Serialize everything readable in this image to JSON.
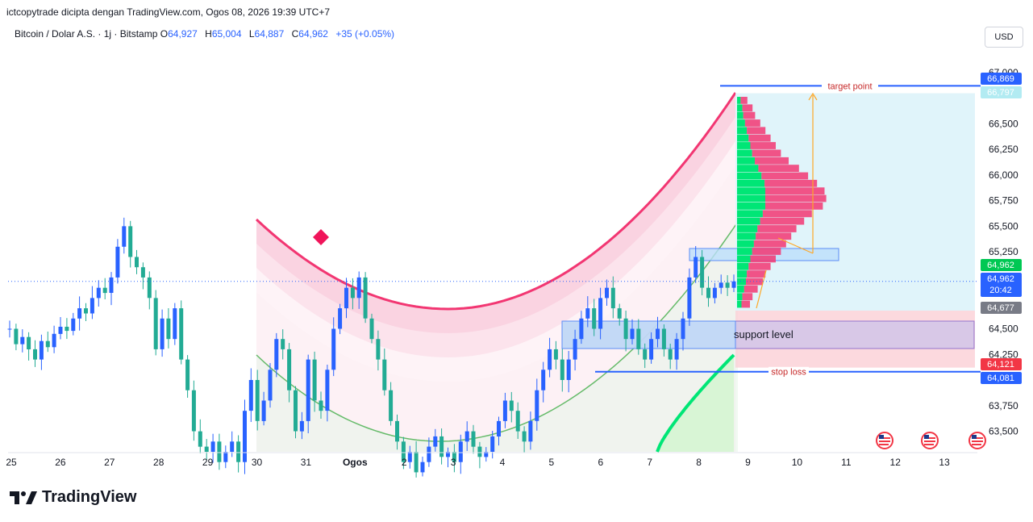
{
  "header": {
    "caption": "ictcopytrade dicipta dengan TradingView.com, Ogos 08, 2026 19:39 UTC+7"
  },
  "legend": {
    "symbol": "Bitcoin / Dolar A.S. · 1j · Bitstamp",
    "o_label": "O",
    "o": "64,927",
    "h_label": "H",
    "h": "65,004",
    "l_label": "L",
    "l": "64,887",
    "c_label": "C",
    "c": "64,962",
    "change": "+35 (+0.05%)"
  },
  "currency_button": "USD",
  "footer": {
    "brand": "TradingView"
  },
  "colors": {
    "up": "#2962ff",
    "down": "#22ab94",
    "arc": "#f23672",
    "target": "#2962ff",
    "stop": "#2962ff"
  },
  "chart_data": {
    "type": "line",
    "x_tick_labels": [
      "25",
      "26",
      "27",
      "28",
      "29",
      "30",
      "31",
      "Ogos",
      "2",
      "3",
      "4",
      "5",
      "6",
      "7",
      "8",
      "9",
      "10",
      "11",
      "12",
      "13"
    ],
    "y_tick_labels": [
      67000,
      66500,
      66250,
      66000,
      65750,
      65500,
      65250,
      64500,
      64250,
      63750,
      63500
    ],
    "ylim": [
      63300,
      67250
    ],
    "price_tags": [
      {
        "value": 66869,
        "label": "66,869",
        "color": "#2962ff"
      },
      {
        "value": 66797,
        "label": "66,797",
        "color": "#b2ebf2"
      },
      {
        "value": 64962,
        "label": "64,962",
        "color": "#00c853"
      },
      {
        "value": 64962,
        "label": "64,962",
        "label2": "20:42",
        "color": "#2962ff"
      },
      {
        "value": 64677,
        "label": "64,677",
        "color": "#787b86"
      },
      {
        "value": 64121,
        "label": "64,121",
        "color": "#f23645"
      },
      {
        "value": 64081,
        "label": "64,081",
        "color": "#2962ff"
      }
    ],
    "annotations": {
      "target": "target point",
      "support": "support level",
      "stop": "stop loss"
    },
    "series": [
      {
        "values": [
          64500,
          64350,
          64420,
          64300,
          64200,
          64380,
          64320,
          64450,
          64520,
          64480,
          64600,
          64700,
          64650,
          64800,
          64900,
          64850,
          65000,
          65300,
          65500,
          65200,
          65100,
          65000,
          64800,
          64300,
          64600,
          64400,
          64700,
          64200,
          63900,
          63500,
          63350,
          63300,
          63400,
          63200,
          63300,
          63400,
          63200,
          63700,
          64000,
          63600,
          63800,
          64100,
          64400,
          64300,
          63900,
          63500,
          63600,
          64200,
          63800,
          63700,
          64100,
          64500,
          64700,
          64900,
          64800,
          65000,
          64600,
          64400,
          64200,
          63900,
          63600,
          63400,
          63200,
          63300,
          63100,
          63200,
          63350,
          63450,
          63250,
          63300,
          63200,
          63400,
          63500,
          63350,
          63250,
          63300,
          63450,
          63600,
          63800,
          63700,
          63500,
          63400,
          63600,
          63900,
          64100,
          64300,
          64200,
          64000,
          64200,
          64400,
          64600,
          64700,
          64500,
          64800,
          64900,
          64700,
          64600,
          64400,
          64500,
          64300,
          64200,
          64400,
          64500,
          64300,
          64200,
          64400,
          64600,
          65000,
          65200,
          64900,
          64800,
          64900,
          64950,
          64900,
          64962
        ]
      }
    ]
  }
}
